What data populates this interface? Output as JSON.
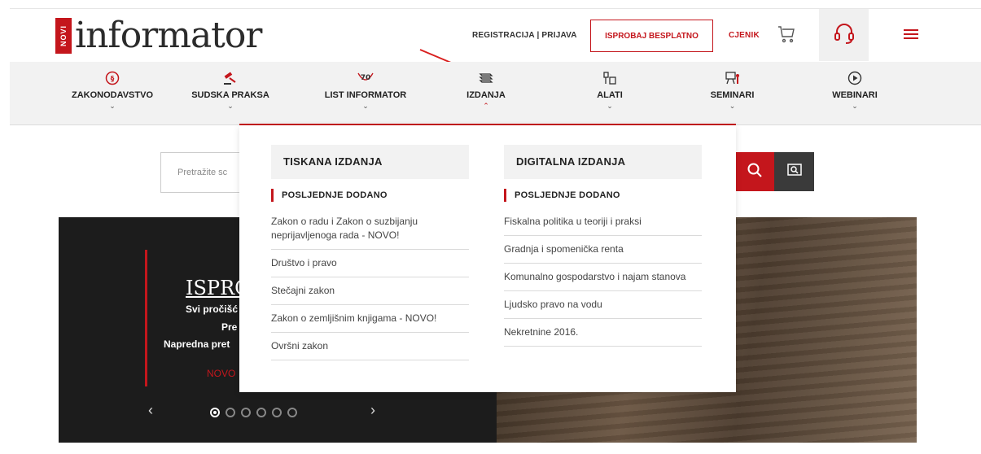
{
  "header": {
    "logo_badge": "NOVI",
    "logo_text": "informator",
    "registration": "REGISTRACIJA | PRIJAVA",
    "try_free": "ISPROBAJ BESPLATNO",
    "pricing": "CJENIK",
    "cart_icon": "cart-icon",
    "support_icon": "headset-icon",
    "menu_icon": "hamburger-icon",
    "accent_color": "#c4161c"
  },
  "nav": {
    "items": [
      {
        "label": "ZAKONODAVSTVO",
        "icon": "paragraph-icon",
        "chevron": "⌄"
      },
      {
        "label": "SUDSKA PRAKSA",
        "icon": "gavel-icon",
        "chevron": "⌄"
      },
      {
        "label": "LIST INFORMATOR",
        "icon": "anniversary-70-icon",
        "icon_text": "70",
        "chevron": "⌄"
      },
      {
        "label": "IZDANJA",
        "icon": "books-icon",
        "chevron": "⌃"
      },
      {
        "label": "ALATI",
        "icon": "tools-icon",
        "chevron": "⌄"
      },
      {
        "label": "SEMINARI",
        "icon": "presenter-icon",
        "chevron": "⌄"
      },
      {
        "label": "WEBINARI",
        "icon": "play-icon",
        "chevron": "⌄"
      }
    ]
  },
  "search": {
    "placeholder": "Pretražite sc"
  },
  "dropdown": {
    "print": {
      "title": "TISKANA IZDANJA",
      "subtitle": "POSLJEDNJE DODANO",
      "items": [
        "Zakon o radu i Zakon o suzbijanju neprijavljenoga rada - NOVO!",
        "Društvo i pravo",
        "Stečajni zakon",
        "Zakon o zemljišnim knjigama - NOVO!",
        "Ovršni zakon"
      ]
    },
    "digital": {
      "title": "DIGITALNA IZDANJA",
      "subtitle": "POSLJEDNJE DODANO",
      "items": [
        "Fiskalna politika u teoriji i praksi",
        "Gradnja i spomenička renta",
        "Komunalno gospodarstvo i najam stanova",
        "Ljudsko pravo na vodu",
        "Nekretnine 2016."
      ]
    }
  },
  "hero": {
    "title": "ISPRO",
    "line1": "Svi pročišć",
    "line2": "Pre",
    "line3": "Napredna pret",
    "line4": "NOVO",
    "prev": "‹",
    "next": "›",
    "slides_total": 6,
    "active_slide": 1
  }
}
